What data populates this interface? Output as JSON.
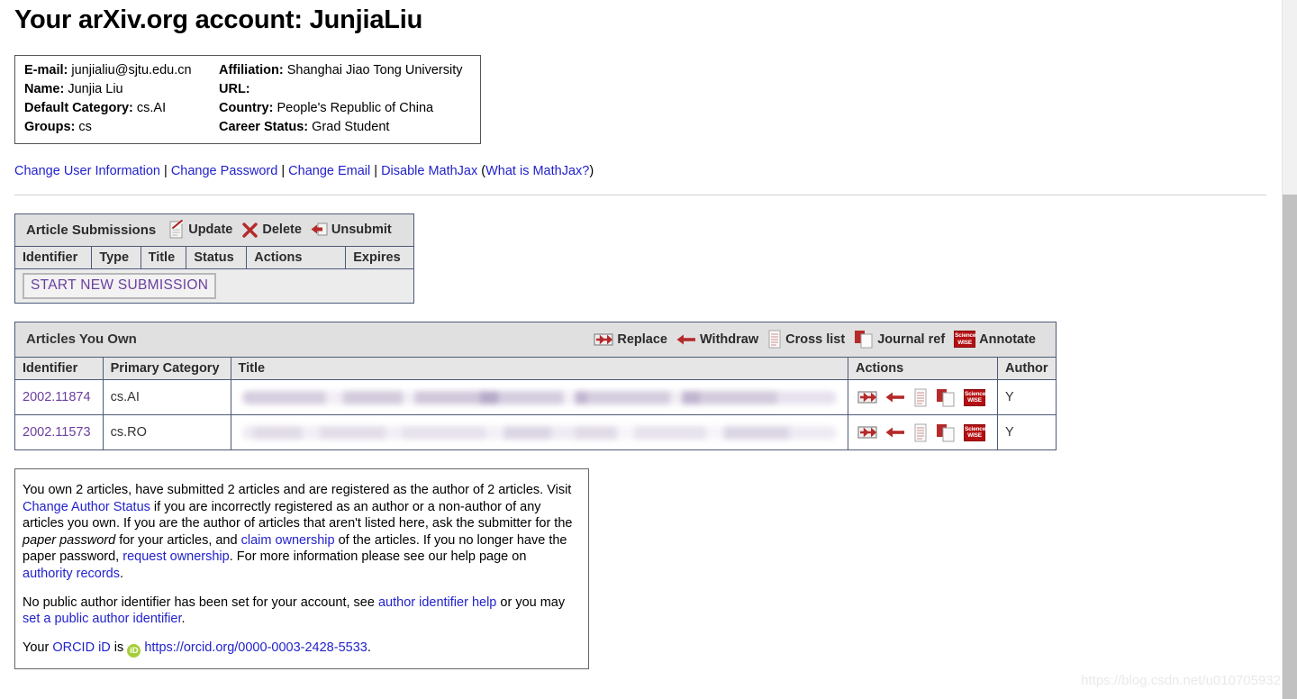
{
  "page": {
    "title": "Your arXiv.org account: JunjiaLiu",
    "watermark": "https://blog.csdn.net/u010705932"
  },
  "profile": {
    "rows": [
      {
        "label_left": "E-mail:",
        "value_left": "junjialiu@sjtu.edu.cn",
        "label_right": "Affiliation:",
        "value_right": "Shanghai Jiao Tong University"
      },
      {
        "label_left": "Name:",
        "value_left": "Junjia Liu",
        "label_right": "URL:",
        "value_right": ""
      },
      {
        "label_left": "Default Category:",
        "value_left": "cs.AI",
        "label_right": "Country:",
        "value_right": "People's Republic of China"
      },
      {
        "label_left": "Groups:",
        "value_left": "cs",
        "label_right": "Career Status:",
        "value_right": "Grad Student"
      }
    ]
  },
  "account_links": {
    "change_user_information": "Change User Information",
    "change_password": "Change Password",
    "change_email": "Change Email",
    "disable_mathjax": "Disable MathJax",
    "what_is_mathjax": "What is MathJax?",
    "separator": "|",
    "paren_open": "(",
    "paren_close": ")"
  },
  "submissions": {
    "banner_title": "Article Submissions",
    "legend": [
      {
        "icon": "update-note-icon",
        "label": "Update"
      },
      {
        "icon": "delete-x-icon",
        "label": "Delete"
      },
      {
        "icon": "unsubmit-icon",
        "label": "Unsubmit"
      }
    ],
    "columns": [
      "Identifier",
      "Type",
      "Title",
      "Status",
      "Actions",
      "Expires"
    ],
    "rows": [],
    "start_new_label": "START NEW SUBMISSION"
  },
  "owned": {
    "banner_title": "Articles You Own",
    "legend": [
      {
        "icon": "replace-icon",
        "label": "Replace"
      },
      {
        "icon": "withdraw-arrow-icon",
        "label": "Withdraw"
      },
      {
        "icon": "cross-list-icon",
        "label": "Cross list"
      },
      {
        "icon": "journal-ref-icon",
        "label": "Journal ref"
      },
      {
        "icon": "sciencewise-icon",
        "label": "Annotate"
      }
    ],
    "columns": [
      "Identifier",
      "Primary Category",
      "Title",
      "Actions",
      "Author"
    ],
    "rows": [
      {
        "identifier": "2002.11874",
        "primary_category": "cs.AI",
        "title": "",
        "author": "Y"
      },
      {
        "identifier": "2002.11573",
        "primary_category": "cs.RO",
        "title": "",
        "author": "Y"
      }
    ],
    "sciencewise_label_line1": "Science",
    "sciencewise_label_line2": "WISE"
  },
  "notes": {
    "p1": {
      "t1": "You own 2 articles, have submitted 2 articles and are registered as the author of 2 articles. Visit ",
      "l1": "Change Author Status",
      "t2": " if you are incorrectly registered as an author or a non-author of any articles you own. If you are the author of articles that aren't listed here, ask the submitter for the ",
      "em1": "paper password",
      "t3": " for your articles, and ",
      "l2": "claim ownership",
      "t4": " of the articles. If you no longer have the paper password, ",
      "l3": "request ownership",
      "t5": ". For more information please see our help page on ",
      "l4": "authority records",
      "t6": "."
    },
    "p2": {
      "t1": "No public author identifier has been set for your account, see ",
      "l1": "author identifier help",
      "t2": " or you may ",
      "l2": "set a public author identifier",
      "t3": "."
    },
    "p3": {
      "t1": "Your ",
      "l1": "ORCID iD",
      "t2": " is ",
      "icon": "orcid-icon",
      "icon_text": "iD",
      "l2": "https://orcid.org/0000-0003-2428-5533",
      "t3": "."
    }
  },
  "scrollbar": {
    "up_arrow": "scroll-up-arrow-icon"
  },
  "colors": {
    "link": "#2222cc",
    "visited_link": "#6b3fa0",
    "table_border": "#4c5a78",
    "header_bg": "#e6e6e6",
    "banner_bg": "#e0e0e0",
    "sciencewise_red": "#b40f12",
    "orcid_green": "#a6ce39"
  }
}
